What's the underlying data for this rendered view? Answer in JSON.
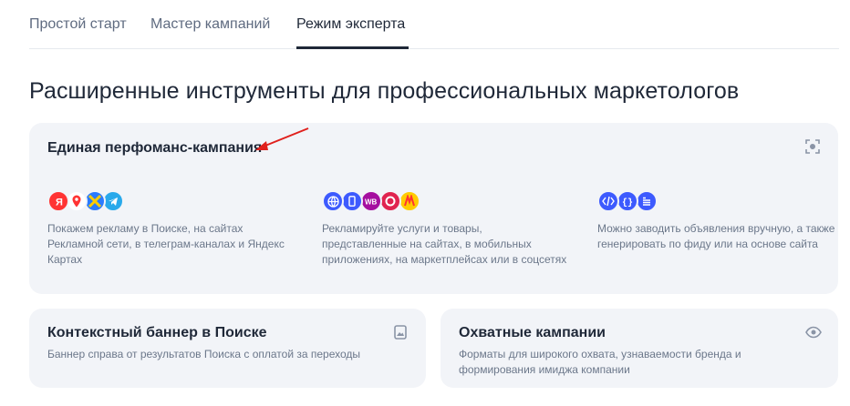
{
  "tabs": [
    {
      "label": "Простой старт"
    },
    {
      "label": "Мастер кампаний"
    },
    {
      "label": "Режим эксперта"
    }
  ],
  "active_tab": 2,
  "page_title": "Расширенные инструменты для профессиональных маркетологов",
  "perf_card": {
    "title": "Единая перфоманс-кампания",
    "columns": [
      {
        "desc": "Покажем рекламу в Поиске, на сайтах Рекламной сети, в телеграм-каналах и Яндекс Картах",
        "icons": [
          "yandex-icon",
          "maps-pin-icon",
          "apps-icon",
          "telegram-icon"
        ]
      },
      {
        "desc": "Рекламируйте услуги и товары, представленные на сайтах, в мобильных приложениях, на маркетплейсах или в соцсетях",
        "icons": [
          "globe-icon",
          "mobile-icon",
          "wildberries-icon",
          "ozon-icon",
          "yandex-market-icon"
        ]
      },
      {
        "desc": "Можно заводить объявления вручную, а также генерировать по фиду или на основе сайта",
        "icons": [
          "code-icon",
          "feed-icon",
          "list-icon"
        ]
      }
    ]
  },
  "banner_card": {
    "title": "Контекстный баннер в Поиске",
    "desc": "Баннер справа от результатов Поиска с оплатой за переходы"
  },
  "reach_card": {
    "title": "Охватные кампании",
    "desc": "Форматы для широкого охвата, узнаваемости бренда и формирования имиджа компании"
  },
  "colors": {
    "text_primary": "#1f2838",
    "text_secondary": "#6b778a",
    "card_bg": "#f2f4f8",
    "accent_blue": "#3d5afe",
    "arrow_red": "#e0201c"
  }
}
